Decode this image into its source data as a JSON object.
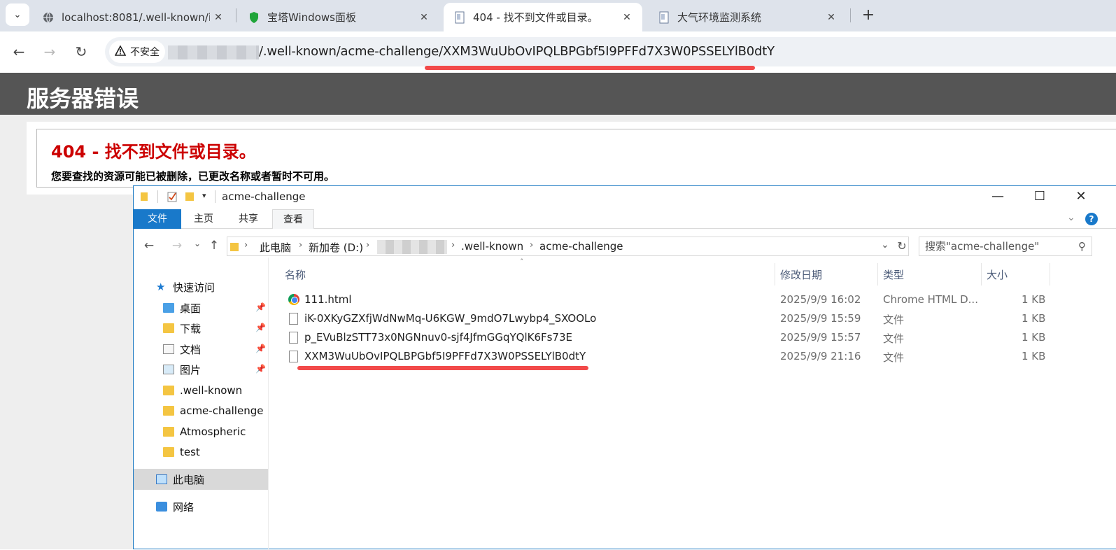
{
  "browser": {
    "tabs": [
      {
        "title": "localhost:8081/.well-known/i",
        "icon": "globe-icon",
        "active": false
      },
      {
        "title": "宝塔Windows面板",
        "icon": "shield-icon",
        "active": false
      },
      {
        "title": "404 - 找不到文件或目录。",
        "icon": "document-icon",
        "active": true
      },
      {
        "title": "大气环境监测系统",
        "icon": "document-icon",
        "active": false
      }
    ],
    "new_tab": "+",
    "security_label": "不安全",
    "url": "/.well-known/acme-challenge/XXM3WuUbOvIPQLBPGbf5I9PFFd7X3W0PSSELYlB0dtY",
    "highlight_color": "#f24a4a"
  },
  "page": {
    "header_title": "服务器错误",
    "error_title": "404 - 找不到文件或目录。",
    "error_description": "您要查找的资源可能已被删除，已更改名称或者暂时不可用。",
    "error_color": "#cc0000"
  },
  "explorer": {
    "title": "acme-challenge",
    "ribbon_tabs": [
      "文件",
      "主页",
      "共享",
      "查看"
    ],
    "breadcrumb": [
      "此电脑",
      "新加卷 (D:)",
      ".well-known",
      "acme-challenge"
    ],
    "search_placeholder": "搜索\"acme-challenge\"",
    "nav": {
      "quick_access": "快速访问",
      "items": [
        "桌面",
        "下载",
        "文档",
        "图片",
        ".well-known",
        "acme-challenge",
        "Atmospheric",
        "test"
      ],
      "this_pc": "此电脑",
      "network": "网络"
    },
    "columns": [
      "名称",
      "修改日期",
      "类型",
      "大小"
    ],
    "files": [
      {
        "name": "111.html",
        "date": "2025/9/9 16:02",
        "type": "Chrome HTML D...",
        "size": "1 KB",
        "icon": "chrome-icon"
      },
      {
        "name": "iK-0XKyGZXfjWdNwMq-U6KGW_9mdO7Lwybp4_SXOOLo",
        "date": "2025/9/9 15:59",
        "type": "文件",
        "size": "1 KB",
        "icon": "file-icon"
      },
      {
        "name": "p_EVuBlzSTT73x0NGNnuv0-sjf4JfmGGqYQlK6Fs73E",
        "date": "2025/9/9 15:57",
        "type": "文件",
        "size": "1 KB",
        "icon": "file-icon"
      },
      {
        "name": "XXM3WuUbOvIPQLBPGbf5I9PFFd7X3W0PSSELYlB0dtY",
        "date": "2025/9/9 21:16",
        "type": "文件",
        "size": "1 KB",
        "icon": "file-icon"
      }
    ]
  }
}
